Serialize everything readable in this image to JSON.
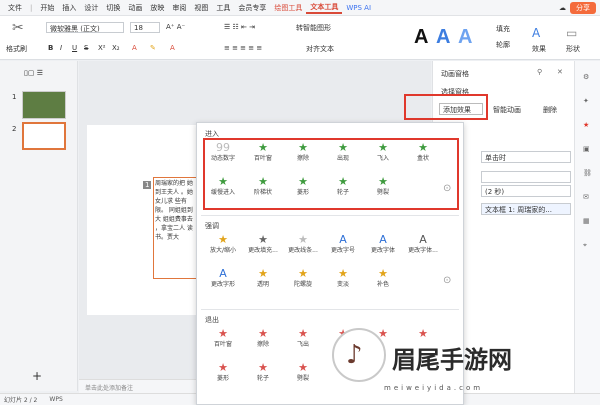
{
  "menubar": {
    "items": [
      "文件",
      "开始",
      "插入",
      "设计",
      "切换",
      "动画",
      "放映",
      "审阅",
      "视图",
      "工具",
      "会员专享",
      "绘图工具",
      "文本工具"
    ],
    "ai_label": "WPS AI",
    "share_label": "分享"
  },
  "ribbon": {
    "format_brush": "格式刷",
    "font_name": "微软雅黑 (正文)",
    "font_size": "18",
    "convert_smartart": "转智能图形",
    "align_text": "对齐文本",
    "fill": "填充",
    "outline": "轮廓",
    "effects": "效果",
    "shapes": "形状"
  },
  "slides": [
    {
      "number": "1"
    },
    {
      "number": "2"
    }
  ],
  "notes_placeholder": "单击此处添加备注",
  "status": {
    "slide_count": "幻灯片 2 / 2",
    "app": "WPS"
  },
  "animation_pane": {
    "title": "动画窗格",
    "select_pane": "选择窗格",
    "add_effect": "添加效果",
    "smart_animation": "智能动画",
    "delete": "删除",
    "start_value": "单击时",
    "speed_value": "(2 秒)",
    "item_value": "文本框 1: 周瑞家的..."
  },
  "effects": {
    "entrance_title": "进入",
    "entrance": [
      {
        "label": "动态数字",
        "icon": "number-icon",
        "color": "#bbbbbb"
      },
      {
        "label": "百叶窗",
        "icon": "star-icon",
        "color": "#3f9b3f"
      },
      {
        "label": "擦除",
        "icon": "star-icon",
        "color": "#3f9b3f"
      },
      {
        "label": "出现",
        "icon": "star-icon",
        "color": "#3f9b3f"
      },
      {
        "label": "飞入",
        "icon": "star-icon",
        "color": "#3f9b3f"
      },
      {
        "label": "盒状",
        "icon": "star-icon",
        "color": "#3f9b3f"
      },
      {
        "label": "缓慢进入",
        "icon": "star-icon",
        "color": "#3f9b3f"
      },
      {
        "label": "阶梯状",
        "icon": "star-icon",
        "color": "#3f9b3f"
      },
      {
        "label": "菱形",
        "icon": "star-icon",
        "color": "#3f9b3f"
      },
      {
        "label": "轮子",
        "icon": "star-icon",
        "color": "#3f9b3f"
      },
      {
        "label": "劈裂",
        "icon": "star-icon",
        "color": "#3f9b3f"
      }
    ],
    "emphasis_title": "强调",
    "emphasis": [
      {
        "label": "放大/缩小",
        "icon": "star-icon",
        "color": "#e2a41a"
      },
      {
        "label": "更改填充...",
        "icon": "star-icon",
        "color": "#666666"
      },
      {
        "label": "更改线条...",
        "icon": "star-icon",
        "color": "#bbbbbb"
      },
      {
        "label": "更改字号",
        "icon": "letter-a-icon",
        "color": "#2d6fd6"
      },
      {
        "label": "更改字体",
        "icon": "letter-a-icon",
        "color": "#2d6fd6"
      },
      {
        "label": "更改字体...",
        "icon": "letter-a-icon",
        "color": "#555555"
      },
      {
        "label": "更改字形",
        "icon": "letter-a-icon",
        "color": "#2d6fd6"
      },
      {
        "label": "透明",
        "icon": "star-icon",
        "color": "#e2a41a"
      },
      {
        "label": "陀螺旋",
        "icon": "star-icon",
        "color": "#e2a41a"
      },
      {
        "label": "变淡",
        "icon": "star-icon",
        "color": "#e2a41a"
      },
      {
        "label": "补色",
        "icon": "star-icon",
        "color": "#e2a41a"
      }
    ],
    "exit_title": "退出",
    "exit": [
      {
        "label": "百叶窗",
        "icon": "star-icon",
        "color": "#d9534f"
      },
      {
        "label": "擦除",
        "icon": "star-icon",
        "color": "#d9534f"
      },
      {
        "label": "飞出",
        "icon": "star-icon",
        "color": "#d9534f"
      },
      {
        "label": "",
        "icon": "star-icon",
        "color": "#d9534f"
      },
      {
        "label": "",
        "icon": "star-icon",
        "color": "#d9534f"
      },
      {
        "label": "",
        "icon": "star-icon",
        "color": "#d9534f"
      },
      {
        "label": "菱形",
        "icon": "star-icon",
        "color": "#d9534f"
      },
      {
        "label": "轮子",
        "icon": "star-icon",
        "color": "#d9534f"
      },
      {
        "label": "劈裂",
        "icon": "star-icon",
        "color": "#d9534f"
      }
    ]
  },
  "slide_text": "周瑞家的把 她到王夫人 。她女儿求 些有限。 同姐姐到大 姐姐费事去 ，拿宝二人 读书。贾大",
  "watermark": {
    "text": "眉尾手游网",
    "url": "meiweiyida.com"
  },
  "colors": {
    "accent": "#d94a38",
    "highlight": "#e0382c",
    "entrance": "#3f9b3f",
    "emphasis": "#e2a41a",
    "exit": "#d9534f"
  }
}
